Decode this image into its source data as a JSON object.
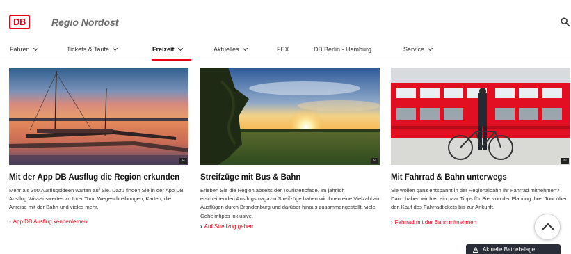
{
  "header": {
    "logo": "DB",
    "site_title": "Regio Nordost",
    "search_icon": "search-icon"
  },
  "nav": {
    "items": [
      {
        "label": "Fahren",
        "has_dropdown": true,
        "active": false
      },
      {
        "label": "Tickets & Tarife",
        "has_dropdown": true,
        "active": false
      },
      {
        "label": "Freizeit",
        "has_dropdown": true,
        "active": true
      },
      {
        "label": "Aktuelles",
        "has_dropdown": true,
        "active": false
      },
      {
        "label": "FEX",
        "has_dropdown": false,
        "active": false
      },
      {
        "label": "DB Berlin - Hamburg",
        "has_dropdown": false,
        "active": false
      },
      {
        "label": "Service",
        "has_dropdown": true,
        "active": false
      }
    ],
    "accent_color": "#ec0016"
  },
  "cards": [
    {
      "image": "lake-jetty-sunset-image",
      "title": "Mit der App DB Ausflug die Region erkunden",
      "text": "Mehr als 300 Ausflugsideen warten auf Sie. Dazu finden Sie in der App DB Ausflug Wissenswertes zu Ihrer Tour, Wegeschreibungen, Karten, die Anreise mit der Bahn und vieles mehr.",
      "link": "App DB Ausflug kennenlernen"
    },
    {
      "image": "sunset-meadow-tree-image",
      "title": "Streifzüge mit Bus & Bahn",
      "text": "Erleben Sie die Region abseits der Touristenpfade. Im jährlich erscheinenden Ausflugsmagazin Streifzüge haben wir Ihnen eine Vielzahl an Ausflügen durch Brandenburg und darüber hinaus zusammengestellt, viele Geheimtipps inklusive.",
      "link": "Auf Streifzug gehen"
    },
    {
      "image": "cyclist-red-train-image",
      "title": "Mit Fahrrad & Bahn unterwegs",
      "text": "Sie wollen ganz entspannt in der Regionalbahn Ihr Fahrrad mitnehmen? Dann haben wir hier ein paar Tipps für Sie: von der Planung Ihrer Tour über den Kauf des Fahrradtickets bis zur Ankunft.",
      "link": "Fahrrad mit der Bahn mitnehmen"
    }
  ],
  "image_badge": "©",
  "status_pill": {
    "label": "Aktuelle Betriebslage",
    "icon": "warning-icon"
  },
  "scroll_top_icon": "chevron-up-icon"
}
